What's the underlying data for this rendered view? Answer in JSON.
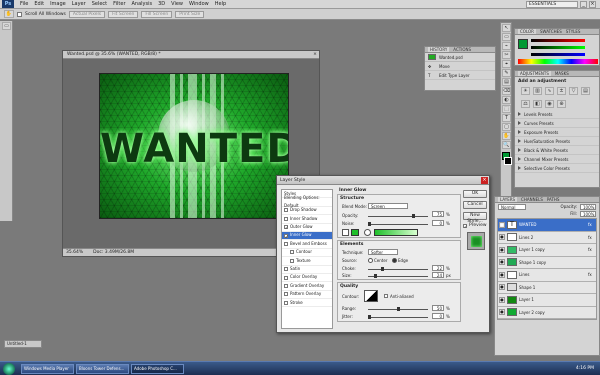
{
  "app": {
    "logo": "Ps",
    "workspace": "ESSENTIALS",
    "win_min": "_",
    "win_max": "□",
    "win_close": "×"
  },
  "menu": [
    "File",
    "Edit",
    "Image",
    "Layer",
    "Select",
    "Filter",
    "Analysis",
    "3D",
    "View",
    "Window",
    "Help"
  ],
  "options_bar": {
    "scroll_all_windows": "Scroll All Windows",
    "buttons": [
      "Actual Pixels",
      "Fit Screen",
      "Fill Screen",
      "Print Size"
    ]
  },
  "tools": [
    "▭",
    "⌖",
    "✂",
    "⌁",
    "✎",
    "▤",
    "⌫",
    "◐",
    "⬚",
    "T",
    "↖",
    "▢",
    "✋",
    "🔍"
  ],
  "document": {
    "title": "Wanted.psd @ 35.6% (WANTED, RGB/8) *",
    "close": "×",
    "art_text": "WANTED",
    "zoom": "35.64%",
    "doc_info": "Doc: 3.49M/26.8M"
  },
  "history_panel": {
    "tabs": [
      "HISTORY",
      "ACTIONS"
    ],
    "items": [
      "Wanted.psd",
      "Move",
      "Edit Type Layer"
    ]
  },
  "color_panel": {
    "tabs": [
      "COLOR",
      "SWATCHES",
      "STYLES"
    ]
  },
  "adjustments_panel": {
    "tabs": [
      "ADJUSTMENTS",
      "MASKS"
    ],
    "heading": "Add an adjustment",
    "presets": [
      "Levels Presets",
      "Curves Presets",
      "Exposure Presets",
      "Hue/Saturation Presets",
      "Black & White Presets",
      "Channel Mixer Presets",
      "Selective Color Presets"
    ]
  },
  "layers_panel": {
    "tabs": [
      "LAYERS",
      "CHANNELS",
      "PATHS"
    ],
    "blend": "Normal",
    "opacity_label": "Opacity:",
    "opacity": "100%",
    "fill_label": "Fill:",
    "fill": "100%",
    "layers": [
      {
        "name": "WANTED",
        "fx": "fx",
        "thumb": "T"
      },
      {
        "name": "Lines 2",
        "fx": "fx",
        "thumb": ""
      },
      {
        "name": "Layer 1 copy",
        "fx": "fx",
        "thumb": ""
      },
      {
        "name": "Shape 1 copy",
        "fx": "",
        "thumb": ""
      },
      {
        "name": "Lines",
        "fx": "fx",
        "thumb": ""
      },
      {
        "name": "Shape 1",
        "fx": "",
        "thumb": ""
      },
      {
        "name": "Layer 1",
        "fx": "",
        "thumb": ""
      },
      {
        "name": "Layer 2 copy",
        "fx": "",
        "thumb": ""
      }
    ]
  },
  "layer_style": {
    "title": "Layer Style",
    "close": "×",
    "styles": [
      {
        "label": "Styles",
        "checkbox": false,
        "checked": false
      },
      {
        "label": "Blending Options: Default",
        "checkbox": false,
        "checked": false
      },
      {
        "label": "Drop Shadow",
        "checkbox": true,
        "checked": false
      },
      {
        "label": "Inner Shadow",
        "checkbox": true,
        "checked": false
      },
      {
        "label": "Outer Glow",
        "checkbox": true,
        "checked": true
      },
      {
        "label": "Inner Glow",
        "checkbox": true,
        "checked": true
      },
      {
        "label": "Bevel and Emboss",
        "checkbox": true,
        "checked": false
      },
      {
        "label": "Contour",
        "checkbox": true,
        "checked": false
      },
      {
        "label": "Texture",
        "checkbox": true,
        "checked": false
      },
      {
        "label": "Satin",
        "checkbox": true,
        "checked": false
      },
      {
        "label": "Color Overlay",
        "checkbox": true,
        "checked": false
      },
      {
        "label": "Gradient Overlay",
        "checkbox": true,
        "checked": false
      },
      {
        "label": "Pattern Overlay",
        "checkbox": true,
        "checked": false
      },
      {
        "label": "Stroke",
        "checkbox": true,
        "checked": false
      }
    ],
    "section_title": "Inner Glow",
    "structure": {
      "title": "Structure",
      "blend_mode_label": "Blend Mode:",
      "blend_mode": "Screen",
      "opacity_label": "Opacity:",
      "opacity": "75",
      "noise_label": "Noise:",
      "noise": "0",
      "unit": "%"
    },
    "elements": {
      "title": "Elements",
      "technique_label": "Technique:",
      "technique": "Softer",
      "source_label": "Source:",
      "center": "Center",
      "edge": "Edge",
      "choke_label": "Choke:",
      "choke": "22",
      "size_label": "Size:",
      "size": "24",
      "choke_unit": "%",
      "size_unit": "px"
    },
    "quality": {
      "title": "Quality",
      "contour_label": "Contour:",
      "anti_aliased": "Anti-aliased",
      "range_label": "Range:",
      "range": "50",
      "jitter_label": "Jitter:",
      "jitter": "0",
      "unit": "%"
    },
    "buttons": {
      "ok": "OK",
      "cancel": "Cancel",
      "new_style": "New Style...",
      "preview": "Preview"
    },
    "colors": {
      "glow": "#1fbf2a"
    }
  },
  "taskbar": {
    "items": [
      "Windows Media Player",
      "Bloons Tower Defens...",
      "Adobe Photoshop C..."
    ],
    "clock": "4:16 PM"
  },
  "colors": {
    "accent": "#3a6ec8",
    "glow_green": "#2ecf3a"
  }
}
